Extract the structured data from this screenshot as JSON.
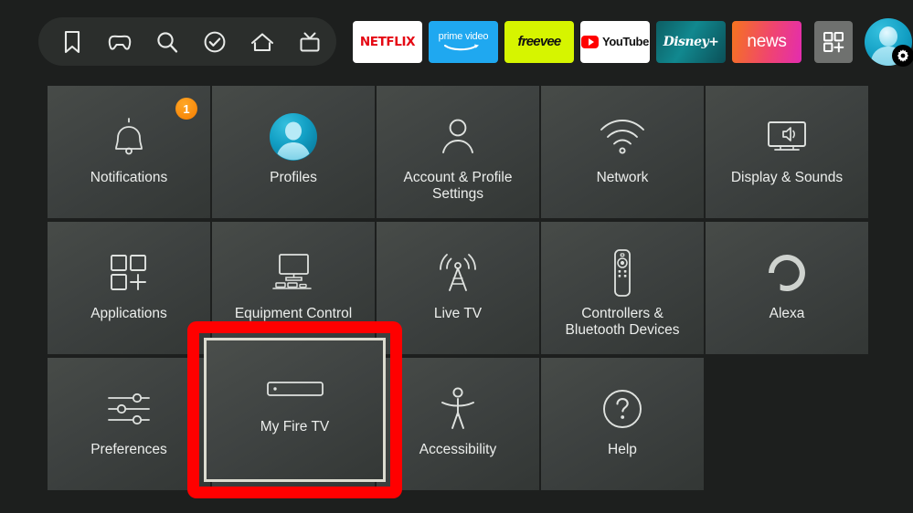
{
  "nav": {
    "icons": [
      {
        "name": "bookmark-icon",
        "label": "Bookmarks"
      },
      {
        "name": "game-controller-icon",
        "label": "Games"
      },
      {
        "name": "search-icon",
        "label": "Search"
      },
      {
        "name": "check-circle-icon",
        "label": "Watchlist"
      },
      {
        "name": "home-icon",
        "label": "Home"
      },
      {
        "name": "live-tv-icon",
        "label": "Live TV"
      }
    ],
    "apps": [
      {
        "id": "netflix",
        "label": "NETFLIX",
        "bg": "#ffffff",
        "fg": "#e50914"
      },
      {
        "id": "prime-video",
        "label": "prime video",
        "bg": "#1fa8f0",
        "fg": "#ffffff"
      },
      {
        "id": "freevee",
        "label": "freevee",
        "bg": "#d6f500",
        "fg": "#111111"
      },
      {
        "id": "youtube",
        "label": "YouTube",
        "bg": "#ffffff",
        "fg": "#111111"
      },
      {
        "id": "disney-plus",
        "label": "Disney+",
        "bg": "#11888f",
        "fg": "#ffffff"
      },
      {
        "id": "news",
        "label": "news",
        "bg": "#f0456f",
        "fg": "#ffffff"
      }
    ],
    "apps_grid_button": "apps-grid-icon",
    "profile_avatar": "avatar",
    "profile_gear": "gear-icon"
  },
  "grid": {
    "tiles": [
      {
        "label": "Notifications",
        "icon": "bell-icon",
        "badge": "1"
      },
      {
        "label": "Profiles",
        "icon": "profile-avatar-icon",
        "badge": ""
      },
      {
        "label": "Account & Profile Settings",
        "icon": "person-outline-icon",
        "badge": ""
      },
      {
        "label": "Network",
        "icon": "wifi-icon",
        "badge": ""
      },
      {
        "label": "Display & Sounds",
        "icon": "tv-speaker-icon",
        "badge": ""
      },
      {
        "label": "Applications",
        "icon": "apps-plus-icon",
        "badge": ""
      },
      {
        "label": "Equipment Control",
        "icon": "equipment-icon",
        "badge": ""
      },
      {
        "label": "Live TV",
        "icon": "broadcast-tower-icon",
        "badge": ""
      },
      {
        "label": "Controllers & Bluetooth Devices",
        "icon": "remote-icon",
        "badge": ""
      },
      {
        "label": "Alexa",
        "icon": "alexa-ring-icon",
        "badge": ""
      },
      {
        "label": "Preferences",
        "icon": "sliders-icon",
        "badge": ""
      },
      {
        "label": "",
        "icon": "",
        "badge": ""
      },
      {
        "label": "Accessibility",
        "icon": "accessibility-icon",
        "badge": ""
      },
      {
        "label": "Help",
        "icon": "question-circle-icon",
        "badge": ""
      }
    ]
  },
  "selected": {
    "label": "My Fire TV",
    "icon": "fire-tv-stick-icon",
    "highlight_color": "#ff0000"
  },
  "colors": {
    "page_bg": "#1d1f1e",
    "tile_bg": "#3d4140",
    "nav_pill_bg": "#2b2e2c",
    "badge_orange": "#f57c00",
    "accent_cyan": "#129fc4",
    "annotation_red": "#ff0000"
  }
}
